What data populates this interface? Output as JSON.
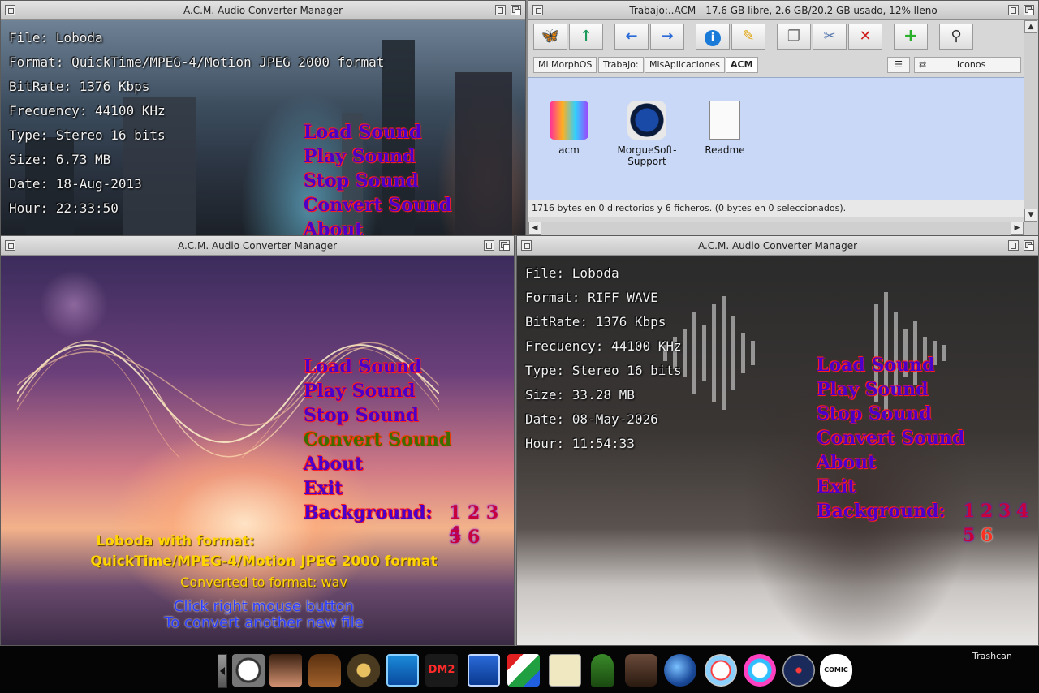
{
  "win_tl": {
    "title": "A.C.M. Audio Converter Manager",
    "info": [
      "File: Loboda",
      "Format: QuickTime/MPEG-4/Motion JPEG 2000 format",
      "BitRate: 1376 Kbps",
      "Frecuency: 44100 KHz",
      "Type: Stereo 16 bits",
      "Size: 6.73 MB",
      "Date: 18-Aug-2013",
      "Hour: 22:33:50"
    ],
    "menu": [
      "Load Sound",
      "Play Sound",
      "Stop Sound",
      "Convert Sound",
      "About"
    ]
  },
  "win_tr": {
    "title": "Trabajo:..ACM - 17.6 GB libre, 2.6 GB/20.2 GB usado, 12% lleno",
    "path": [
      "Mi MorphOS",
      "Trabajo:",
      "MisAplicaciones",
      "ACM"
    ],
    "view_mode": "Iconos",
    "files": [
      "acm",
      "MorgueSoft-Support",
      "Readme"
    ],
    "status": "1716 bytes en 0 directorios y 6 ficheros. (0 bytes en 0 seleccionados).",
    "toolbar_icons": [
      "butterfly-icon",
      "parent-icon",
      "back-icon",
      "forward-icon",
      "info-icon",
      "rename-icon",
      "copy-icon",
      "cut-icon",
      "delete-icon",
      "new-drawer-icon",
      "search-icon"
    ]
  },
  "win_bl": {
    "title": "A.C.M. Audio Converter Manager",
    "menu": [
      "Load Sound",
      "Play Sound",
      "Stop Sound",
      "Convert Sound",
      "About",
      "Exit",
      "Background:"
    ],
    "bg_numbers_row1": "1 2 3 4",
    "bg_numbers_row2": "5 6",
    "result_line1": "Loboda with format:",
    "result_line2": "QuickTime/MPEG-4/Motion JPEG 2000 format",
    "result_line3": "Converted to format: wav",
    "hint_line1": "Click right mouse button",
    "hint_line2": "To convert another new file"
  },
  "win_br": {
    "title": "A.C.M. Audio Converter Manager",
    "info": [
      "File: Loboda",
      "Format: RIFF WAVE",
      "BitRate: 1376 Kbps",
      "Frecuency: 44100 KHz",
      "Type: Stereo 16 bits",
      "Size: 33.28 MB",
      "Date: 08-May-2026",
      "Hour: 11:54:33"
    ],
    "menu": [
      "Load Sound",
      "Play Sound",
      "Stop Sound",
      "Convert Sound",
      "About",
      "Exit",
      "Background:"
    ],
    "bg_numbers_row1": [
      "1",
      "2",
      "3",
      "4"
    ],
    "bg_numbers_row2": [
      "5",
      "6"
    ]
  },
  "dock": {
    "trash_label": "Trashcan",
    "icons": [
      "clock-icon",
      "girl-camera-icon",
      "pendulum-clock-icon",
      "lantern-icon",
      "cpu-monitor-icon",
      "dmg-icon",
      "screen-icon",
      "map-icon",
      "notepad-icon",
      "figure-icon",
      "dragon-icon",
      "globe-icon",
      "safari-icon",
      "mail-icon",
      "compass-icon",
      "comic-icon"
    ],
    "colors": {
      "accent": "#4a00c8",
      "active": "#3b6d00",
      "yellow": "#ffd400"
    }
  }
}
